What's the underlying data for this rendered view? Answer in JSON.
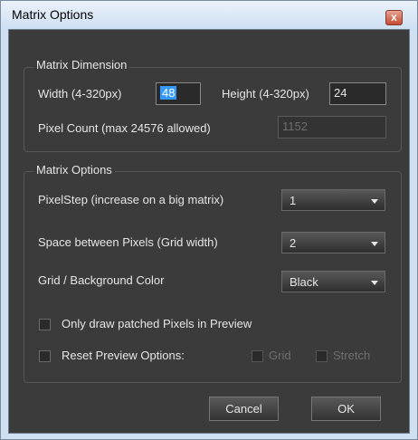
{
  "window": {
    "title": "Matrix Options",
    "close_glyph": "x"
  },
  "matrix_dimension": {
    "legend": "Matrix Dimension",
    "width_label": "Width (4-320px)",
    "width_value": "48",
    "height_label": "Height (4-320px)",
    "height_value": "24",
    "pixel_count_label": "Pixel Count (max 24576 allowed)",
    "pixel_count_value": "1152"
  },
  "matrix_options": {
    "legend": "Matrix Options",
    "pixelstep_label": "PixelStep (increase on a big matrix)",
    "pixelstep_value": "1",
    "space_label": "Space between Pixels (Grid width)",
    "space_value": "2",
    "color_label": "Grid / Background Color",
    "color_value": "Black",
    "only_patched_label": "Only draw patched Pixels in Preview",
    "reset_label": "Reset Preview Options:",
    "grid_label": "Grid",
    "stretch_label": "Stretch"
  },
  "buttons": {
    "cancel": "Cancel",
    "ok": "OK"
  },
  "colors": {
    "client_bg": "#3b3b3b",
    "titlebar": "#cfe0f3",
    "selection": "#3399ff",
    "close": "#c44b33"
  }
}
